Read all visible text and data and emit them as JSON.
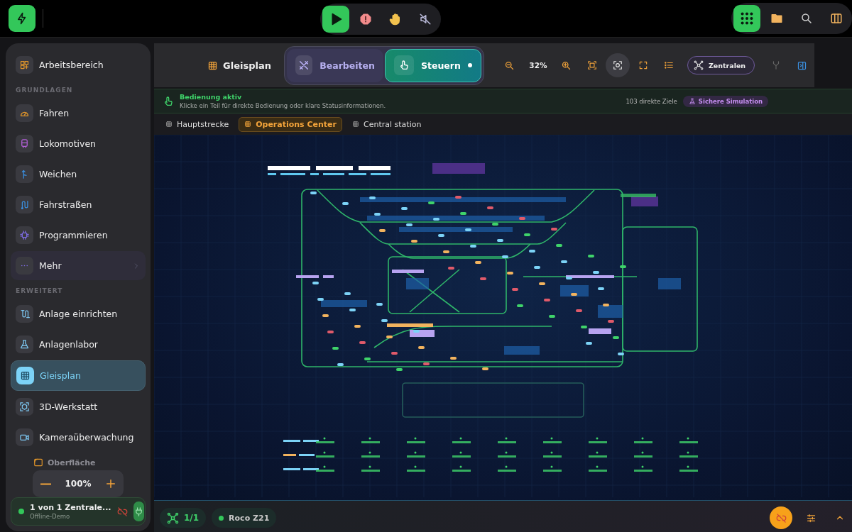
{
  "top_bar": {
    "transport": [
      {
        "kind": "play",
        "selected": true
      },
      {
        "kind": "stop",
        "selected": false
      },
      {
        "kind": "hand",
        "selected": false
      },
      {
        "kind": "mute",
        "selected": false
      }
    ],
    "apps": [
      {
        "kind": "grid",
        "selected": true
      },
      {
        "kind": "folder",
        "selected": false
      },
      {
        "kind": "search",
        "selected": false
      },
      {
        "kind": "columns",
        "selected": false
      }
    ]
  },
  "sidebar": {
    "sections": [
      {
        "items": [
          {
            "label": "Arbeitsbereich",
            "kind": "link",
            "selected": false
          }
        ]
      },
      {
        "heading": "GRUNDLAGEN",
        "items": [
          {
            "label": "Fahren",
            "kind": "link",
            "selected": false
          },
          {
            "label": "Lokomotiven",
            "kind": "link",
            "selected": false
          },
          {
            "label": "Weichen",
            "kind": "link",
            "selected": false
          },
          {
            "label": "Fahrstraßen",
            "kind": "link",
            "selected": false
          },
          {
            "label": "Programmieren",
            "kind": "link",
            "selected": false
          },
          {
            "label": "Mehr",
            "kind": "more",
            "selected": false
          }
        ]
      },
      {
        "heading": "ERWEITERT",
        "items": [
          {
            "label": "Anlage einrichten",
            "kind": "link",
            "selected": false
          },
          {
            "label": "Anlagenlabor",
            "kind": "link",
            "selected": false
          },
          {
            "label": "Gleisplan",
            "kind": "link",
            "selected": true
          },
          {
            "label": "3D-Werkstatt",
            "kind": "link",
            "selected": false
          },
          {
            "label": "Kameraüberwachung",
            "kind": "link",
            "selected": false
          }
        ]
      }
    ],
    "surface": {
      "label": "Oberfläche",
      "value": "100%"
    },
    "connection": {
      "title": "1 von 1 Zentrale...",
      "subtitle": "Offline-Demo",
      "online": true
    }
  },
  "toolbar": {
    "title": "Gleisplan",
    "modes": [
      {
        "label": "Bearbeiten",
        "kind": "edit",
        "selected": false
      },
      {
        "label": "Steuern",
        "kind": "control",
        "selected": true
      }
    ],
    "zoom": "32%",
    "tools": [
      {
        "kind": "fit",
        "selected": false
      },
      {
        "kind": "center",
        "selected": true
      },
      {
        "kind": "fullscreen",
        "selected": false
      },
      {
        "kind": "list",
        "selected": false
      }
    ],
    "centrals_button": "Zentralen"
  },
  "status": {
    "title": "Bedienung aktiv",
    "message": "Klicke ein Teil für direkte Bedienung oder klare Statusinformationen.",
    "targets": "103 direkte Ziele",
    "badge": "Sichere Simulation"
  },
  "tabs": [
    {
      "label": "Hauptstrecke",
      "selected": false
    },
    {
      "label": "Operations Center",
      "selected": true
    },
    {
      "label": "Central station",
      "selected": false
    }
  ],
  "bottom_bar": {
    "count": "1/1",
    "central": "Roco Z21",
    "central_online": true
  }
}
